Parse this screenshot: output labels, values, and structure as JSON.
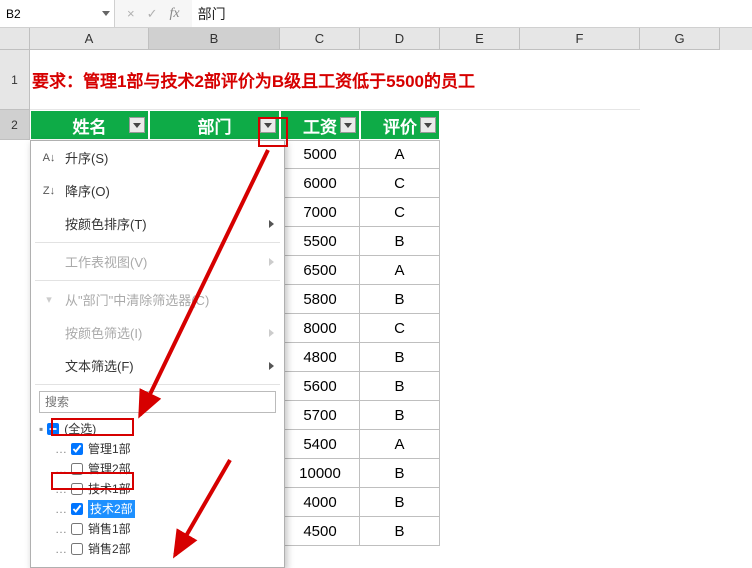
{
  "formula_bar": {
    "name_box": "B2",
    "cancel_glyph": "×",
    "accept_glyph": "✓",
    "fx_glyph": "fx",
    "formula": "部门"
  },
  "col_labels": [
    "A",
    "B",
    "C",
    "D",
    "E",
    "F",
    "G"
  ],
  "active_col_index": 1,
  "row1_visible": "1",
  "row2_visible": "2",
  "requirement": "要求：管理1部与技术2部评价为B级且工资低于5500的员工",
  "headers": [
    "姓名",
    "部门",
    "工资",
    "评价"
  ],
  "data_rows": [
    {
      "salary": "5000",
      "rating": "A"
    },
    {
      "salary": "6000",
      "rating": "C"
    },
    {
      "salary": "7000",
      "rating": "C"
    },
    {
      "salary": "5500",
      "rating": "B"
    },
    {
      "salary": "6500",
      "rating": "A"
    },
    {
      "salary": "5800",
      "rating": "B"
    },
    {
      "salary": "8000",
      "rating": "C"
    },
    {
      "salary": "4800",
      "rating": "B"
    },
    {
      "salary": "5600",
      "rating": "B"
    },
    {
      "salary": "5700",
      "rating": "B"
    },
    {
      "salary": "5400",
      "rating": "A"
    },
    {
      "salary": "10000",
      "rating": "B"
    },
    {
      "salary": "4000",
      "rating": "B"
    },
    {
      "salary": "4500",
      "rating": "B"
    }
  ],
  "menu": {
    "sort_asc": "升序(S)",
    "sort_desc": "降序(O)",
    "sort_color": "按颜色排序(T)",
    "sheet_view": "工作表视图(V)",
    "clear_filter": "从\"部门\"中清除筛选器(C)",
    "filter_color": "按颜色筛选(I)",
    "text_filter": "文本筛选(F)",
    "search_placeholder": "搜索"
  },
  "filter_tree": {
    "select_all": "(全选)",
    "items": [
      {
        "label": "管理1部",
        "checked": true
      },
      {
        "label": "管理2部",
        "checked": false
      },
      {
        "label": "技术1部",
        "checked": false
      },
      {
        "label": "技术2部",
        "checked": true,
        "selected": true
      },
      {
        "label": "销售1部",
        "checked": false
      },
      {
        "label": "销售2部",
        "checked": false
      }
    ]
  }
}
